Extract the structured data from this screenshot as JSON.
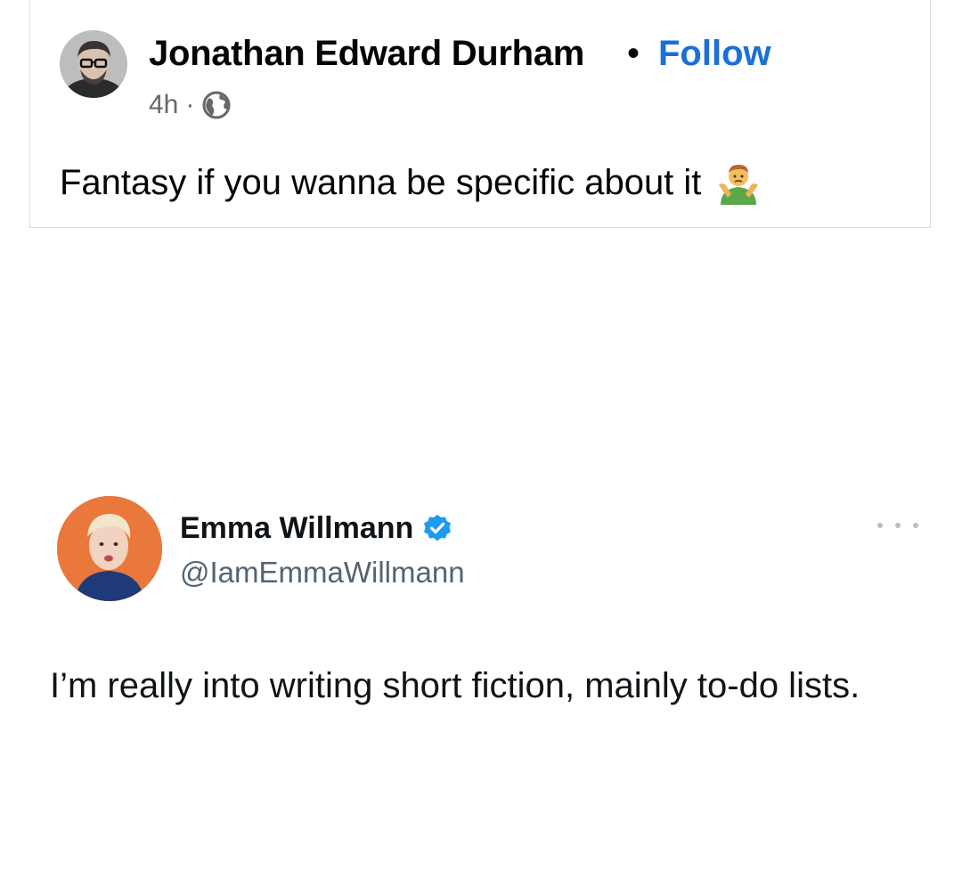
{
  "post": {
    "author": "Jonathan Edward Durham",
    "separator": "•",
    "follow_label": "Follow",
    "time": "4h",
    "meta_separator": "·",
    "audience_icon": "globe-icon",
    "text": "Fantasy if you wanna be specific about it",
    "emoji_icon": "person-shrugging-icon"
  },
  "tweet": {
    "name": "Emma Willmann",
    "handle": "@IamEmmaWillmann",
    "verified_icon": "verified-badge-icon",
    "more_icon": "more-options-icon",
    "text": "I’m really into writing short fiction, mainly to-do lists."
  },
  "colors": {
    "follow_link": "#1b6fd6",
    "meta_gray": "#65676b",
    "verified_blue": "#1d9bf0",
    "handle_gray": "#536471",
    "tweet_avatar_bg": "#e9783a"
  }
}
